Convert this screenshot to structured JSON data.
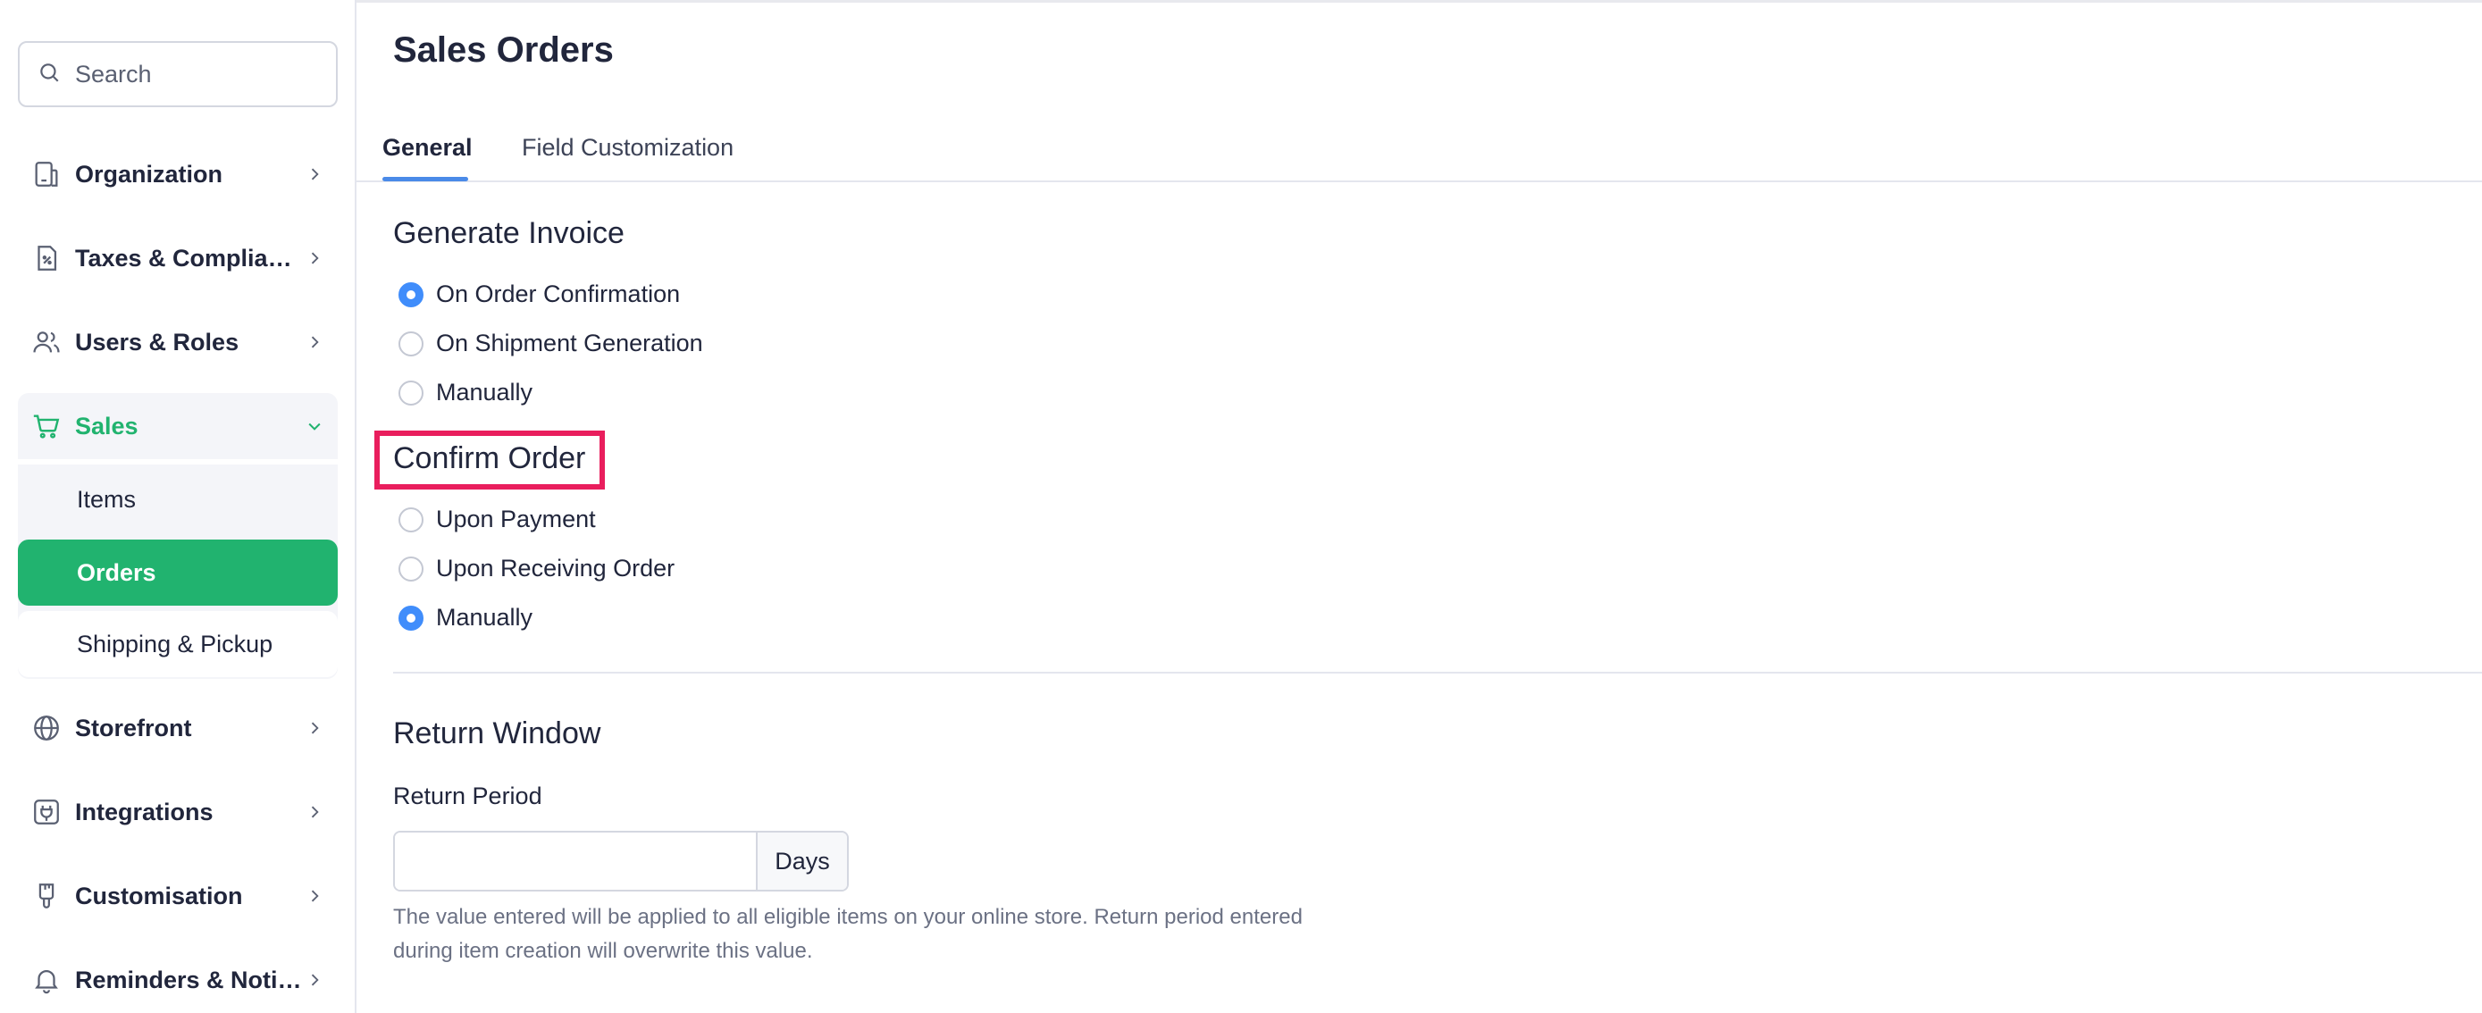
{
  "sidebar": {
    "search_placeholder": "Search",
    "items": [
      {
        "label": "Organization"
      },
      {
        "label": "Taxes & Compliance"
      },
      {
        "label": "Users & Roles"
      },
      {
        "label": "Sales"
      },
      {
        "label": "Storefront"
      },
      {
        "label": "Integrations"
      },
      {
        "label": "Customisation"
      },
      {
        "label": "Reminders & Notific..."
      }
    ],
    "sales_sub": [
      {
        "label": "Items"
      },
      {
        "label": "Orders"
      },
      {
        "label": "Shipping & Pickup"
      }
    ]
  },
  "page": {
    "title": "Sales Orders",
    "tabs": [
      {
        "label": "General"
      },
      {
        "label": "Field Customization"
      }
    ]
  },
  "generate_invoice": {
    "title": "Generate Invoice",
    "options": [
      {
        "label": "On Order Confirmation",
        "selected": true
      },
      {
        "label": "On Shipment Generation",
        "selected": false
      },
      {
        "label": "Manually",
        "selected": false
      }
    ]
  },
  "confirm_order": {
    "title": "Confirm Order",
    "options": [
      {
        "label": "Upon Payment",
        "selected": false
      },
      {
        "label": "Upon Receiving Order",
        "selected": false
      },
      {
        "label": "Manually",
        "selected": true
      }
    ]
  },
  "return_window": {
    "title": "Return Window",
    "field_label": "Return Period",
    "value": "",
    "unit": "Days",
    "help": "The value entered will be applied to all eligible items on your online store. Return period entered during item creation will overwrite this value."
  },
  "colors": {
    "accent_green": "#21b36f",
    "radio_blue": "#408dfb",
    "highlight": "#e91e5d"
  }
}
